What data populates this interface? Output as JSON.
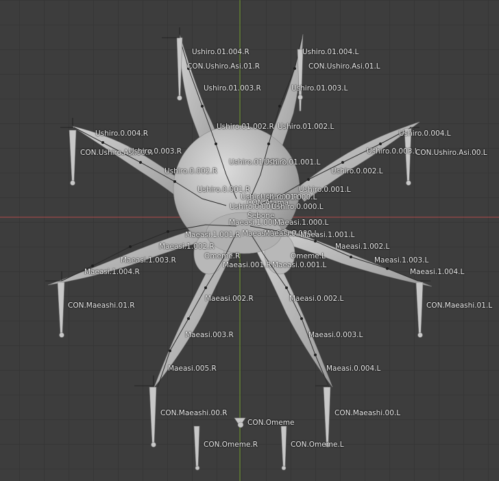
{
  "viewport": {
    "background_color": "#3d3d3d",
    "grid_color": "#363636",
    "x_axis_color": "#b34a4a",
    "y_axis_color": "#6e9a2c",
    "mesh_color": "#c0c0c0"
  },
  "labels": {
    "ushiro_01_004_r": "Ushiro.01.004.R",
    "ushiro_01_004_l": "Ushiro.01.004.L",
    "con_ushiro_asi_01_r": "CON.Ushiro.Asi.01.R",
    "con_ushiro_asi_01_l": "CON.Ushiro.Asi.01.L",
    "ushiro_01_003_r": "Ushiro.01.003.R",
    "ushiro_01_003_l": "Ushiro.01.003.L",
    "ushiro_01_002_r": "Ushiro.01.002.R",
    "ushiro_01_002_l": "Ushiro.01.002.L",
    "ushiro_0_004_r": "Ushiro.0.004.R",
    "ushiro_0_004_l": "Ushiro.0.004.L",
    "con_ushiro_asi_00_r": "CON.Ushiro.Asi.00.R",
    "ushiro_0_003_r": "Ushiro.0.003.R",
    "ushiro_0_003_l": "Ushiro.0.003.L",
    "con_ushiro_asi_00_l": "CON.Ushiro.Asi.00.L",
    "ushiro_01_001_r": "Ushiro.01.001.R",
    "ushiro_01_001_l": "Ushiro.01.001.L",
    "ushiro_0_002_r": "Ushiro.0.002.R",
    "ushiro_0_002_l": "Ushiro.0.002.L",
    "ushiro_0_001_r": "Ushiro.0.001.R",
    "ushiro_0_001_l": "Ushiro.0.001.L",
    "ushiro_01_000_r": "Ushiro.01.000.R",
    "ushiro_01_000_l": "Ushiro.01.000.L",
    "con_atama": "CON.Atama",
    "ushiro_0_000_r": "Ushiro.0.000.R",
    "ushiro_0_000_l": "Ushiro.0.000.L",
    "sebone": "Sebone",
    "maeasi_1_000_r": "Maeasi.1.000.R",
    "maeasi_1_000_l": "Maeasi.1.000.L",
    "maeasi_1_001_r": "Maeasi.1.001.R",
    "maeasi_0_000_r": "Maeasi.0.000.R",
    "maeasi_0_000_l": "Maeasi.0.000.L",
    "maeasi_1_001_l": "Maeasi.1.001.L",
    "maeasi_1_002_r": "Maeasi.1.002.R",
    "maeasi_1_002_l": "Maeasi.1.002.L",
    "omeme_r": "Omeme.R",
    "omeme_l": "Omeme.L",
    "maeasi_1_003_r": "Maeasi.1.003.R",
    "maeasi_1_003_l": "Maeasi.1.003.L",
    "maeasi_001_r": "Maeasi.001.R",
    "maeasi_0_001_l": "Maeasi.0.001.L",
    "maeasi_1_004_r": "Maeasi.1.004.R",
    "maeasi_1_004_l": "Maeasi.1.004.L",
    "con_maeashi_01_r": "CON.Maeashi.01.R",
    "con_maeashi_01_l": "CON.Maeashi.01.L",
    "maeasi_002_r": "Maeasi.002.R",
    "maeasi_0_002_l": "Maeasi.0.002.L",
    "maeasi_003_r": "Maeasi.003.R",
    "maeasi_0_003_l": "Maeasi.0.003.L",
    "maeasi_005_r": "Maeasi.005.R",
    "maeasi_0_004_l": "Maeasi.0.004.L",
    "con_maeashi_00_r": "CON.Maeashi.00.R",
    "con_maeashi_00_l": "CON.Maeashi.00.L",
    "con_omeme": "CON.Omeme",
    "con_omeme_r": "CON.Omeme.R",
    "con_omeme_l": "CON.Omeme.L"
  }
}
